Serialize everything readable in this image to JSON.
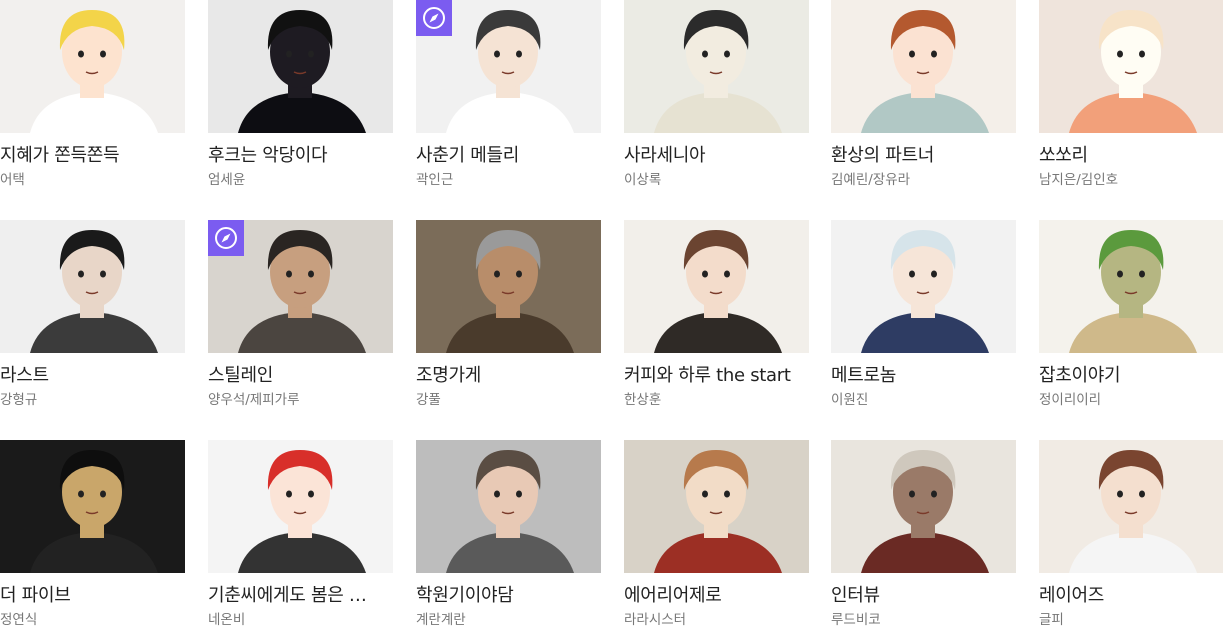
{
  "items": [
    {
      "title": "지혜가 쫀득쫀득",
      "author": "어택",
      "badge": false,
      "thumb": {
        "bg": "#f2f0ee",
        "hair": "#f3d449",
        "skin": "#fde3cf",
        "cloth": "#ffffff"
      }
    },
    {
      "title": "후크는 악당이다",
      "author": "엄세윤",
      "badge": false,
      "thumb": {
        "bg": "#e8e8e8",
        "hair": "#111111",
        "skin": "#1e1b22",
        "cloth": "#0d0d12"
      }
    },
    {
      "title": "사춘기 메들리",
      "author": "곽인근",
      "badge": true,
      "thumb": {
        "bg": "#f1f1f1",
        "hair": "#3a3a3a",
        "skin": "#f5e3d4",
        "cloth": "#ffffff"
      }
    },
    {
      "title": "사라세니아",
      "author": "이상록",
      "badge": false,
      "thumb": {
        "bg": "#ebebe4",
        "hair": "#2b2b2b",
        "skin": "#f2ece0",
        "cloth": "#e6e2d2"
      }
    },
    {
      "title": "환상의 파트너",
      "author": "김예린/장유라",
      "badge": false,
      "thumb": {
        "bg": "#f4efe9",
        "hair": "#b4592f",
        "skin": "#fbe2d2",
        "cloth": "#b1c8c5"
      }
    },
    {
      "title": "쏘쏘리",
      "author": "남지은/김인호",
      "badge": false,
      "thumb": {
        "bg": "#efe4dc",
        "hair": "#f7e3c8",
        "skin": "#fffdf4",
        "cloth": "#f2a07a"
      }
    },
    {
      "title": "라스트",
      "author": "강형규",
      "badge": false,
      "thumb": {
        "bg": "#efefef",
        "hair": "#1a1a1a",
        "skin": "#e8d6c8",
        "cloth": "#3b3b3b"
      }
    },
    {
      "title": "스틸레인",
      "author": "양우석/제피가루",
      "badge": true,
      "thumb": {
        "bg": "#d8d4ce",
        "hair": "#2a2522",
        "skin": "#c79f7f",
        "cloth": "#4b4540"
      }
    },
    {
      "title": "조명가게",
      "author": "강풀",
      "badge": false,
      "thumb": {
        "bg": "#7b6c59",
        "hair": "#9a9a9a",
        "skin": "#b88d6a",
        "cloth": "#4a3b2c"
      }
    },
    {
      "title": "커피와 하루 the start",
      "author": "한상훈",
      "badge": false,
      "thumb": {
        "bg": "#f2efea",
        "hair": "#6b4431",
        "skin": "#f3dccb",
        "cloth": "#2f2a26"
      }
    },
    {
      "title": "메트로놈",
      "author": "이원진",
      "badge": false,
      "thumb": {
        "bg": "#f2f2f2",
        "hair": "#d6e4ea",
        "skin": "#f6e5d8",
        "cloth": "#2e3c63"
      }
    },
    {
      "title": "잡초이야기",
      "author": "정이리이리",
      "badge": false,
      "thumb": {
        "bg": "#f4f2ec",
        "hair": "#5b9a3d",
        "skin": "#b5b682",
        "cloth": "#cfb98a"
      }
    },
    {
      "title": "더 파이브",
      "author": "정연식",
      "badge": false,
      "thumb": {
        "bg": "#1a1a1a",
        "hair": "#0e0e0e",
        "skin": "#c9a66a",
        "cloth": "#222222"
      }
    },
    {
      "title": "기춘씨에게도 봄은 …",
      "author": "네온비",
      "badge": false,
      "thumb": {
        "bg": "#f4f4f4",
        "hair": "#d82f2a",
        "skin": "#fbe4d7",
        "cloth": "#333333"
      }
    },
    {
      "title": "학원기이야담",
      "author": "계란계란",
      "badge": false,
      "thumb": {
        "bg": "#bdbdbd",
        "hair": "#5a4d43",
        "skin": "#e8c9b5",
        "cloth": "#5a5a5a"
      }
    },
    {
      "title": "에어리어제로",
      "author": "라라시스터",
      "badge": false,
      "thumb": {
        "bg": "#d8d2c7",
        "hair": "#b77a4c",
        "skin": "#f2dcc7",
        "cloth": "#9c2f24"
      }
    },
    {
      "title": "인터뷰",
      "author": "루드비코",
      "badge": false,
      "thumb": {
        "bg": "#e9e5de",
        "hair": "#cfc8bd",
        "skin": "#9a7a68",
        "cloth": "#6a2a24"
      }
    },
    {
      "title": "레이어즈",
      "author": "글피",
      "badge": false,
      "thumb": {
        "bg": "#f1ebe4",
        "hair": "#7a4530",
        "skin": "#f4dfcf",
        "cloth": "#f5f5f5"
      }
    }
  ]
}
